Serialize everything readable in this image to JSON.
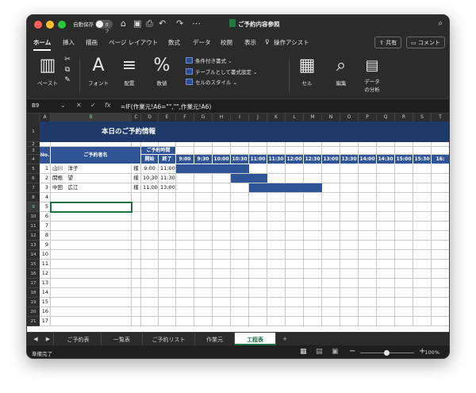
{
  "titlebar": {
    "autosave_label": "自動保存",
    "autosave_state": "オフ",
    "document_title": "ご予約内容参照",
    "icons": [
      "home-icon",
      "save-icon",
      "print-icon",
      "undo-icon",
      "redo-icon",
      "more-icon"
    ]
  },
  "tabs": [
    "ホーム",
    "挿入",
    "描画",
    "ページ レイアウト",
    "数式",
    "データ",
    "校閲",
    "表示",
    "操作アシスト"
  ],
  "share_label": "共有",
  "comment_label": "コメント",
  "ribbon": {
    "paste": "ペースト",
    "font": "フォント",
    "align": "配置",
    "number": "数値",
    "cond_format": "条件付き書式",
    "format_table": "テーブルとして書式設定",
    "cell_style": "セルのスタイル",
    "cells": "セル",
    "editing": "編集",
    "analyze_line1": "データ",
    "analyze_line2": "の分析"
  },
  "formula_bar": {
    "name_box": "B9",
    "fx": "fx",
    "formula": "=IF(作業元!A6=\"\",\"\",作業元!A6)"
  },
  "columns": [
    "A",
    "B",
    "C",
    "D",
    "E",
    "F",
    "G",
    "H",
    "I",
    "J",
    "K",
    "L",
    "M",
    "N",
    "O",
    "P",
    "Q",
    "R",
    "S",
    "T"
  ],
  "rows": [
    "1",
    "2",
    "3",
    "4",
    "5",
    "6",
    "7",
    "8",
    "9",
    "10",
    "11",
    "12",
    "13",
    "14",
    "15",
    "16",
    "17",
    "18",
    "19",
    "20",
    "21"
  ],
  "sheet": {
    "title": "本日のご予約情報",
    "hdr_no": "No.",
    "hdr_name": "ご予約者名",
    "hdr_time": "ご予約時間",
    "hdr_start": "開始",
    "hdr_end": "終了",
    "time_slots": [
      "9:00",
      "9:30",
      "10:00",
      "10:30",
      "11:00",
      "11:30",
      "12:00",
      "12:30",
      "13:00",
      "13:30",
      "14:00",
      "14:30",
      "15:00",
      "15:30",
      "16:"
    ],
    "bookings": [
      {
        "no": "1",
        "name": "山川　洋子",
        "suffix": "様",
        "start": "9:00",
        "end": "11:00"
      },
      {
        "no": "2",
        "name": "関根　望",
        "suffix": "様",
        "start": "10:30",
        "end": "11:30"
      },
      {
        "no": "3",
        "name": "中田　広江",
        "suffix": "様",
        "start": "11:00",
        "end": "13:00"
      }
    ],
    "more_numbers": [
      "4",
      "5",
      "6",
      "7",
      "8",
      "9",
      "10",
      "11",
      "12",
      "13",
      "14",
      "15",
      "16",
      "17"
    ]
  },
  "sheet_tabs": [
    "ご予約表",
    "一覧表",
    "ご予約リスト",
    "作業元",
    "工程表"
  ],
  "active_sheet": "工程表",
  "status": {
    "ready": "準備完了",
    "zoom": "100%"
  },
  "colors": {
    "banner": "#1f3a68",
    "header": "#2f5597",
    "gantt": "#2f5597",
    "selection": "#1e7145"
  }
}
